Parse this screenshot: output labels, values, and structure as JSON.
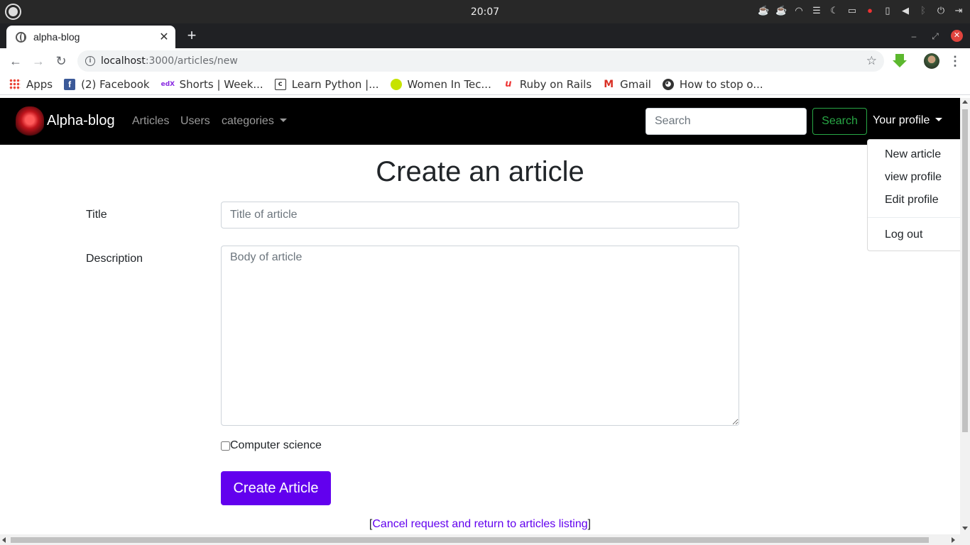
{
  "os": {
    "clock": "20:07"
  },
  "browser": {
    "tab_title": "alpha-blog",
    "url_host": "localhost",
    "url_path": ":3000/articles/new",
    "bookmarks": [
      {
        "label": "Apps",
        "icon": "apps-grid-icon"
      },
      {
        "label": "(2) Facebook",
        "icon": "facebook-icon"
      },
      {
        "label": "Shorts | Week...",
        "icon": "edx-icon"
      },
      {
        "label": "Learn Python |...",
        "icon": "learn-python-icon"
      },
      {
        "label": "Women In Tec...",
        "icon": "tennis-ball-icon"
      },
      {
        "label": "Ruby on Rails",
        "icon": "rails-icon"
      },
      {
        "label": "Gmail",
        "icon": "gmail-icon"
      },
      {
        "label": "How to stop o...",
        "icon": "github-icon"
      }
    ]
  },
  "navbar": {
    "brand": "Alpha-blog",
    "links": [
      "Articles",
      "Users",
      "categories"
    ],
    "search_placeholder": "Search",
    "search_button": "Search",
    "profile_toggle": "Your profile",
    "dropdown": [
      "New article",
      "view profile",
      "Edit profile",
      "Log out"
    ]
  },
  "form": {
    "heading": "Create an article",
    "title_label": "Title",
    "title_placeholder": "Title of article",
    "description_label": "Description",
    "description_placeholder": "Body of article",
    "category_option": "Computer science",
    "submit": "Create Article",
    "cancel_open": "[",
    "cancel_link": "Cancel request and return to articles listing",
    "cancel_close": "]"
  }
}
